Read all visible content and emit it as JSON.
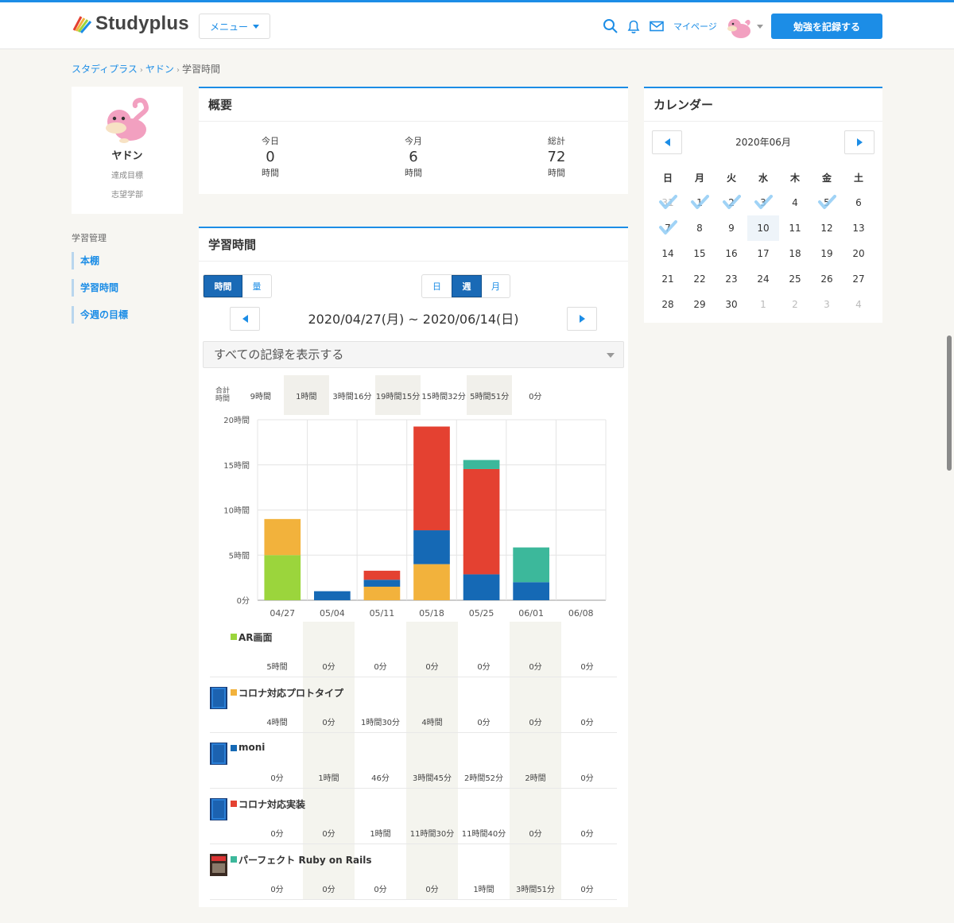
{
  "header": {
    "logo_text": "Studyplus",
    "menu_label": "メニュー",
    "mypage_label": "マイページ",
    "record_button": "勉強を記録する"
  },
  "breadcrumb": {
    "item1": "スタディプラス",
    "item2": "ヤドン",
    "current": "学習時間"
  },
  "profile": {
    "name": "ヤドン",
    "goal": "達成目標",
    "department": "志望学部"
  },
  "sidebar": {
    "title": "学習管理",
    "items": [
      {
        "label": "本棚"
      },
      {
        "label": "学習時間"
      },
      {
        "label": "今週の目標"
      }
    ]
  },
  "summary": {
    "title": "概要",
    "columns": [
      {
        "label": "今日",
        "value": "0",
        "unit": "時間"
      },
      {
        "label": "今月",
        "value": "6",
        "unit": "時間"
      },
      {
        "label": "総計",
        "value": "72",
        "unit": "時間"
      }
    ]
  },
  "study": {
    "title": "学習時間",
    "mode_tabs": [
      {
        "label": "時間",
        "active": true
      },
      {
        "label": "量",
        "active": false
      }
    ],
    "period_tabs": [
      {
        "label": "日",
        "active": false
      },
      {
        "label": "週",
        "active": true
      },
      {
        "label": "月",
        "active": false
      }
    ],
    "range": "2020/04/27(月) ~ 2020/06/14(日)",
    "filter": "すべての記録を表示する",
    "total_label": "合計時間",
    "totals": [
      "9時間",
      "1時間",
      "3時間16分",
      "19時間15分",
      "15時間32分",
      "5時間51分",
      "0分"
    ],
    "subjects": [
      {
        "name": "AR画面",
        "color": "#9bd53c",
        "has_book": false,
        "values": [
          "5時間",
          "0分",
          "0分",
          "0分",
          "0分",
          "0分",
          "0分"
        ]
      },
      {
        "name": "コロナ対応プロトタイプ",
        "color": "#f2b23c",
        "has_book": true,
        "values": [
          "4時間",
          "0分",
          "1時間30分",
          "4時間",
          "0分",
          "0分",
          "0分"
        ]
      },
      {
        "name": "moni",
        "color": "#1569b5",
        "has_book": true,
        "values": [
          "0分",
          "1時間",
          "46分",
          "3時間45分",
          "2時間52分",
          "2時間",
          "0分"
        ]
      },
      {
        "name": "コロナ対応実装",
        "color": "#e44131",
        "has_book": true,
        "values": [
          "0分",
          "0分",
          "1時間",
          "11時間30分",
          "11時間40分",
          "0分",
          "0分"
        ]
      },
      {
        "name": "パーフェクト Ruby on Rails",
        "color": "#3cb89b",
        "has_book": true,
        "values": [
          "0分",
          "0分",
          "0分",
          "0分",
          "1時間",
          "3時間51分",
          "0分"
        ]
      }
    ]
  },
  "chart_data": {
    "type": "bar",
    "stacked": true,
    "categories": [
      "04/27",
      "05/04",
      "05/11",
      "05/18",
      "05/25",
      "06/01",
      "06/08"
    ],
    "series": [
      {
        "name": "AR画面",
        "color": "#9bd53c",
        "values": [
          5,
          0,
          0,
          0,
          0,
          0,
          0
        ]
      },
      {
        "name": "コロナ対応プロトタイプ",
        "color": "#f2b23c",
        "values": [
          4,
          0,
          1.5,
          4,
          0,
          0,
          0
        ]
      },
      {
        "name": "moni",
        "color": "#1569b5",
        "values": [
          0,
          1,
          0.77,
          3.75,
          2.87,
          2,
          0
        ]
      },
      {
        "name": "コロナ対応実装",
        "color": "#e44131",
        "values": [
          0,
          0,
          1,
          11.5,
          11.67,
          0,
          0
        ]
      },
      {
        "name": "パーフェクト Ruby on Rails",
        "color": "#3cb89b",
        "values": [
          0,
          0,
          0,
          0,
          1,
          3.85,
          0
        ]
      }
    ],
    "ylim": [
      0,
      20
    ],
    "yticks": [
      0,
      5,
      10,
      15,
      20
    ],
    "ytick_labels": [
      "0分",
      "5時間",
      "10時間",
      "15時間",
      "20時間"
    ],
    "grid": true
  },
  "calendar": {
    "title": "カレンダー",
    "month": "2020年06月",
    "weekdays": [
      "日",
      "月",
      "火",
      "水",
      "木",
      "金",
      "土"
    ],
    "weeks": [
      [
        {
          "d": "31",
          "dim": false,
          "check": true
        },
        {
          "d": "1",
          "check": true
        },
        {
          "d": "2",
          "check": true
        },
        {
          "d": "3",
          "check": true
        },
        {
          "d": "4"
        },
        {
          "d": "5",
          "check": true
        },
        {
          "d": "6"
        }
      ],
      [
        {
          "d": "7",
          "check": true
        },
        {
          "d": "8"
        },
        {
          "d": "9"
        },
        {
          "d": "10",
          "today": true
        },
        {
          "d": "11"
        },
        {
          "d": "12"
        },
        {
          "d": "13"
        }
      ],
      [
        {
          "d": "14"
        },
        {
          "d": "15"
        },
        {
          "d": "16"
        },
        {
          "d": "17"
        },
        {
          "d": "18"
        },
        {
          "d": "19"
        },
        {
          "d": "20"
        }
      ],
      [
        {
          "d": "21"
        },
        {
          "d": "22"
        },
        {
          "d": "23"
        },
        {
          "d": "24"
        },
        {
          "d": "25"
        },
        {
          "d": "26"
        },
        {
          "d": "27"
        }
      ],
      [
        {
          "d": "28"
        },
        {
          "d": "29"
        },
        {
          "d": "30"
        },
        {
          "d": "1",
          "dim": true
        },
        {
          "d": "2",
          "dim": true
        },
        {
          "d": "3",
          "dim": true
        },
        {
          "d": "4",
          "dim": true
        }
      ]
    ]
  },
  "colors": {
    "accent": "#1c8de6",
    "active_tab": "#1a6ab6",
    "check": "#8fcbf4"
  }
}
